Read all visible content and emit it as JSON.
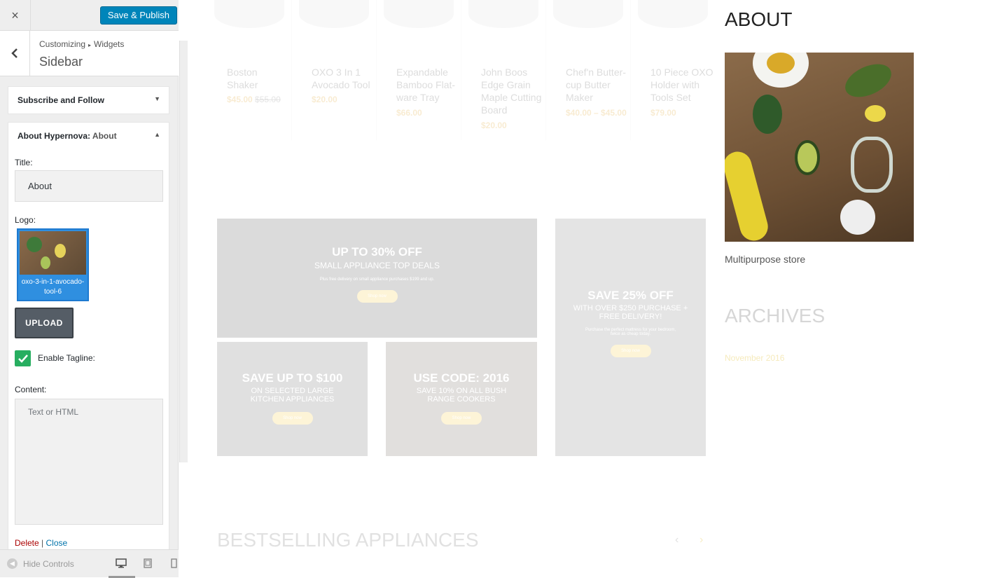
{
  "topbar": {
    "close_icon": "×",
    "publish_label": "Save & Publish"
  },
  "header": {
    "breadcrumb_parent": "Customizing",
    "breadcrumb_sep": "▸",
    "breadcrumb_child": "Widgets",
    "title": "Sidebar"
  },
  "widgets": [
    {
      "title": "Subscribe and Follow",
      "subtitle": "",
      "toggle": "▼"
    },
    {
      "title": "About Hypernova: ",
      "subtitle": "About",
      "toggle": "▲"
    }
  ],
  "about_form": {
    "title_label": "Title:",
    "title_value": "About",
    "logo_label": "Logo:",
    "logo_caption": "oxo-3-in-1-avocado-tool-6",
    "upload_label": "UPLOAD",
    "tagline_label": "Enable Tagline:",
    "tagline_checked": true,
    "content_label": "Content:",
    "content_placeholder": "Text or HTML",
    "delete_label": "Delete",
    "link_sep": "|",
    "close_label": "Close"
  },
  "footer": {
    "hide_controls": "Hide Controls"
  },
  "preview": {
    "products": [
      {
        "name": "Boston Shaker",
        "price": "$45.00",
        "old_price": "$55.00"
      },
      {
        "name": "OXO 3 In 1 Avocado Tool",
        "price": "$20.00",
        "old_price": ""
      },
      {
        "name": "Expandable Bamboo Flat-ware Tray",
        "price": "$66.00",
        "old_price": ""
      },
      {
        "name": "John Boos Edge Grain Maple Cutting Board",
        "price": "$20.00",
        "old_price": ""
      },
      {
        "name": "Chef'n Butter-cup Butter Maker",
        "price": "$40.00 – $45.00",
        "old_price": ""
      },
      {
        "name": "10 Piece OXO Holder with Tools Set",
        "price": "$79.00",
        "old_price": ""
      }
    ],
    "banners": [
      {
        "headline": "UP TO 30% OFF",
        "sub": "SMALL APPLIANCE TOP DEALS",
        "small": "Plus free delivery on small appliance purchases $199 and up.",
        "btn": "Shop now"
      },
      {
        "headline": "SAVE 25% OFF",
        "sub": "WITH OVER $250 PURCHASE + FREE DELIVERY!",
        "small": "Purchase the perfect mattress for your bedroom, twice as cheap today.",
        "btn": "Shop now"
      },
      {
        "headline": "SAVE UP TO $100",
        "sub": "ON SELECTED LARGE KITCHEN APPLIANCES",
        "small": "",
        "btn": "Shop now"
      },
      {
        "headline": "USE CODE: 2016",
        "sub": "SAVE 10% ON ALL BUSH RANGE COOKERS",
        "small": "",
        "btn": "Shop now"
      }
    ],
    "sidebar_about_title": "ABOUT",
    "sidebar_about_tagline": "Multipurpose store",
    "archives_title": "ARCHIVES",
    "archives_link": "November 2016",
    "bestselling_title": "BESTSELLING APPLIANCES",
    "prev_icon": "‹",
    "next_icon": "›"
  }
}
